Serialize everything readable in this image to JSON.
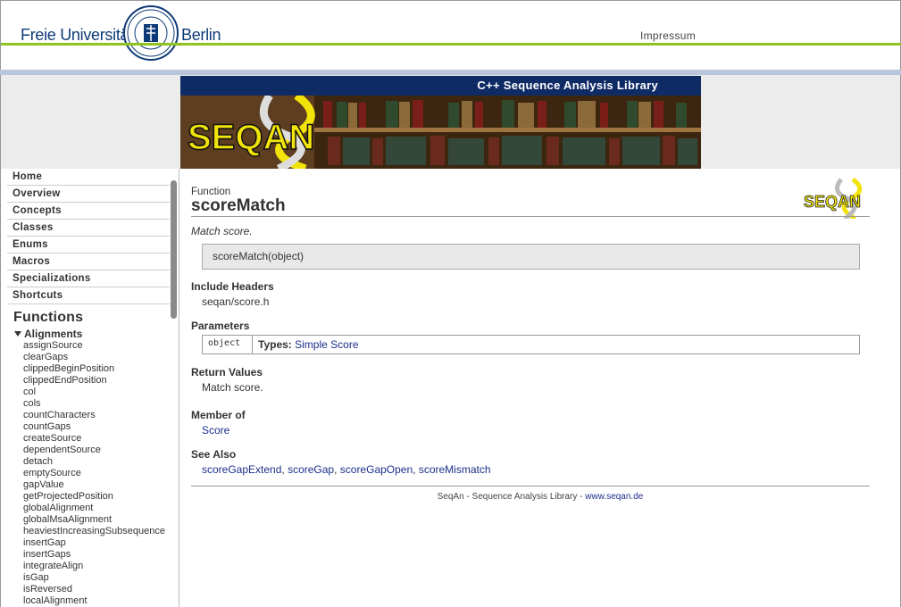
{
  "header": {
    "uni_left": "Freie Universität",
    "uni_right": "Berlin",
    "impressum": "Impressum"
  },
  "banner": {
    "title": "C++ Sequence Analysis Library",
    "logo_text": "SEQAN"
  },
  "sidebar": {
    "nav": [
      "Home",
      "Overview",
      "Concepts",
      "Classes",
      "Enums",
      "Macros",
      "Specializations",
      "Shortcuts"
    ],
    "heading": "Functions",
    "group": "Alignments",
    "functions": [
      "assignSource",
      "clearGaps",
      "clippedBeginPosition",
      "clippedEndPosition",
      "col",
      "cols",
      "countCharacters",
      "countGaps",
      "createSource",
      "dependentSource",
      "detach",
      "emptySource",
      "gapValue",
      "getProjectedPosition",
      "globalAlignment",
      "globalMsaAlignment",
      "heaviestIncreasingSubsequence",
      "insertGap",
      "insertGaps",
      "integrateAlign",
      "isGap",
      "isReversed",
      "localAlignment"
    ]
  },
  "content": {
    "kind": "Function",
    "title": "scoreMatch",
    "summary": "Match score.",
    "signature": "scoreMatch(object)",
    "include_h": "Include Headers",
    "include_v": "seqan/score.h",
    "params_h": "Parameters",
    "param_name": "object",
    "param_types_label": "Types:",
    "param_type": "Simple Score",
    "return_h": "Return Values",
    "return_v": "Match score.",
    "member_h": "Member of",
    "member_v": "Score",
    "seealso_h": "See Also",
    "seealso": [
      "scoreGapExtend",
      "scoreGap",
      "scoreGapOpen",
      "scoreMismatch"
    ],
    "logo_text": "SEQAN"
  },
  "footer": {
    "text": "SeqAn - Sequence Analysis Library - ",
    "link": "www.seqan.de"
  },
  "colors": {
    "accent_green": "#8fc31f",
    "navy": "#0f2b66",
    "link": "#1b2f8c",
    "logo_yellow": "#f2e40a"
  }
}
